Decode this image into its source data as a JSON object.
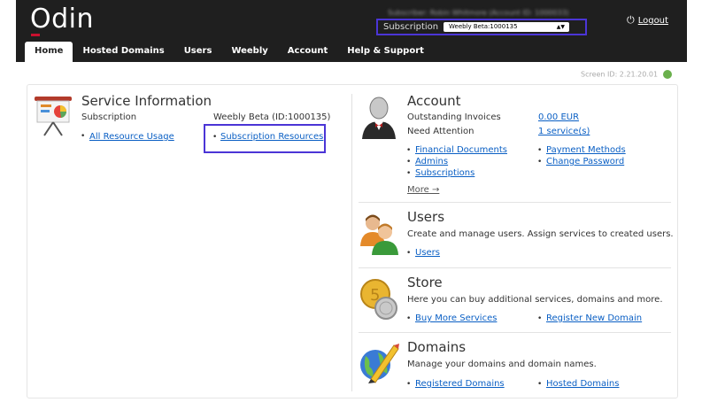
{
  "header": {
    "logo": "Odin",
    "user_info": "Subscriber: Robin Whitmore (Account ID: 1000033)",
    "subscription_label": "Subscription",
    "subscription_value": "Weebly Beta:1000135",
    "logout": "Logout"
  },
  "nav": {
    "tabs": [
      "Home",
      "Hosted Domains",
      "Users",
      "Weebly",
      "Account",
      "Help & Support"
    ]
  },
  "screen_id": "Screen ID: 2.21.20.01",
  "service": {
    "title": "Service Information",
    "subscription_label": "Subscription",
    "subscription_value": "Weebly Beta (ID:1000135)",
    "all_resource_usage": "All Resource Usage",
    "subscription_resources": "Subscription Resources"
  },
  "account": {
    "title": "Account",
    "outstanding_label": "Outstanding Invoices",
    "outstanding_value": "0.00 EUR",
    "attention_label": "Need Attention",
    "attention_value": "1 service(s)",
    "links": [
      "Financial Documents",
      "Admins",
      "Subscriptions",
      "Payment Methods",
      "Change Password"
    ],
    "more": "More →"
  },
  "users": {
    "title": "Users",
    "desc": "Create and manage users. Assign services to created users.",
    "link": "Users"
  },
  "store": {
    "title": "Store",
    "desc": "Here you can buy additional services, domains and more.",
    "link1": "Buy More Services",
    "link2": "Register New Domain"
  },
  "domains": {
    "title": "Domains",
    "desc": "Manage your domains and domain names.",
    "link1": "Registered Domains",
    "link2": "Hosted Domains"
  }
}
